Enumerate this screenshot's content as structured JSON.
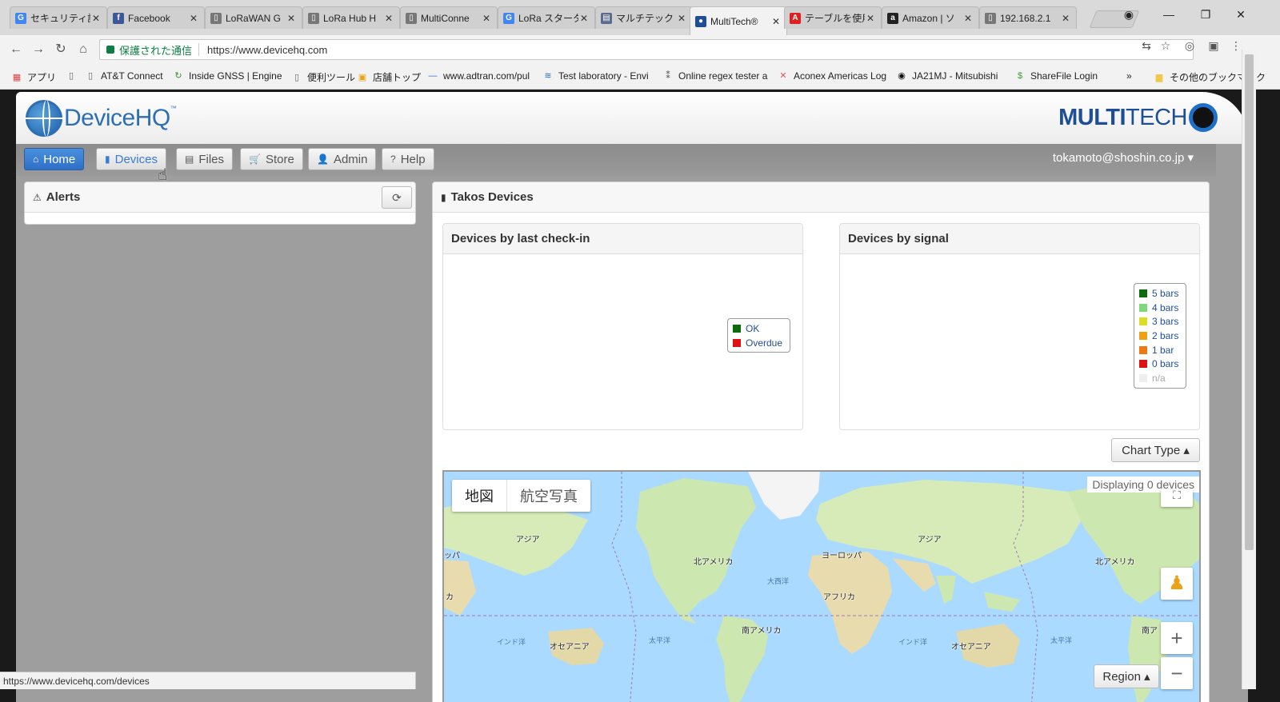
{
  "browser": {
    "tabs": [
      {
        "title": "セキュリティ設",
        "icon": "google-icon",
        "color": "#4285f4",
        "glyph": "G"
      },
      {
        "title": "Facebook",
        "icon": "facebook-icon",
        "color": "#3b5998",
        "glyph": "f"
      },
      {
        "title": "LoRaWAN G",
        "icon": "page-icon",
        "color": "#777777",
        "glyph": "▯"
      },
      {
        "title": "LoRa Hub H",
        "icon": "page-icon",
        "color": "#777777",
        "glyph": "▯"
      },
      {
        "title": "MultiConne",
        "icon": "page-icon",
        "color": "#777777",
        "glyph": "▯"
      },
      {
        "title": "LoRa スタータ",
        "icon": "google-icon",
        "color": "#4285f4",
        "glyph": "G"
      },
      {
        "title": "マルチテック L",
        "icon": "app-icon",
        "color": "#5a6b8c",
        "glyph": "▤"
      },
      {
        "title": "MultiTech®",
        "icon": "multitech-icon",
        "color": "#1e4f96",
        "glyph": "●"
      },
      {
        "title": "テーブルを使用",
        "icon": "adobe-icon",
        "color": "#e02020",
        "glyph": "A"
      },
      {
        "title": "Amazon | ソ",
        "icon": "amazon-icon",
        "color": "#222222",
        "glyph": "a"
      },
      {
        "title": "192.168.2.1",
        "icon": "page-icon",
        "color": "#777777",
        "glyph": "▯"
      }
    ],
    "active_tab": 7,
    "address": {
      "secure_label": "保護された通信",
      "url": "https://www.devicehq.com"
    },
    "bookmarks": [
      {
        "label": "アプリ",
        "icon": "apps-icon"
      },
      {
        "label": "",
        "icon": "page-icon"
      },
      {
        "label": "AT&T Connect",
        "icon": "page-icon"
      },
      {
        "label": "Inside GNSS | Engine",
        "icon": "gnss-icon"
      },
      {
        "label": "便利ツール",
        "icon": "page-icon"
      },
      {
        "label": "店舗トップ",
        "icon": "store-icon"
      },
      {
        "label": "www.adtran.com/pul",
        "icon": "adtran-icon"
      },
      {
        "label": "Test laboratory - Envi",
        "icon": "wifi-icon"
      },
      {
        "label": "Online regex tester a",
        "icon": "regex-icon"
      },
      {
        "label": "Aconex Americas Log",
        "icon": "aconex-icon"
      },
      {
        "label": "JA21MJ - Mitsubishi",
        "icon": "ja21-icon"
      },
      {
        "label": "ShareFile Login",
        "icon": "sharefile-icon"
      },
      {
        "label": "»",
        "icon": ""
      },
      {
        "label": "その他のブックマーク",
        "icon": "folder-icon"
      }
    ],
    "status_url": "https://www.devicehq.com/devices"
  },
  "app": {
    "brand": "DeviceHQ",
    "brand_tm": "™",
    "partner_bold": "MULTI",
    "partner_rest": "TECH",
    "nav": [
      {
        "label": "Home",
        "icon": "home-icon",
        "glyph": "⌂"
      },
      {
        "label": "Devices",
        "icon": "signal-icon",
        "glyph": "▮"
      },
      {
        "label": "Files",
        "icon": "file-icon",
        "glyph": "▤"
      },
      {
        "label": "Store",
        "icon": "cart-icon",
        "glyph": "🛒"
      },
      {
        "label": "Admin",
        "icon": "user-icon",
        "glyph": "👤"
      },
      {
        "label": "Help",
        "icon": "help-icon",
        "glyph": "?"
      }
    ],
    "user": "tokamoto@shoshin.co.jp ▾",
    "alerts_title": "Alerts",
    "devices_title": "Takos Devices",
    "checkin_title": "Devices by last check-in",
    "signal_title": "Devices by signal",
    "checkin_legend": [
      {
        "label": "OK",
        "color": "#0b6b0b"
      },
      {
        "label": "Overdue",
        "color": "#dd1111"
      }
    ],
    "signal_legend": [
      {
        "label": "5 bars",
        "color": "#0b6b0b"
      },
      {
        "label": "4 bars",
        "color": "#7fd67f"
      },
      {
        "label": "3 bars",
        "color": "#dddd22"
      },
      {
        "label": "2 bars",
        "color": "#f0a010"
      },
      {
        "label": "1 bar",
        "color": "#f07810"
      },
      {
        "label": "0 bars",
        "color": "#dd1111"
      },
      {
        "label": "n/a",
        "color": "#eeeeee"
      }
    ],
    "chart_type_label": "Chart Type ▴",
    "map": {
      "type_map": "地図",
      "type_satellite": "航空写真",
      "count_label": "Displaying 0 devices",
      "region_label": "Region ▴",
      "labels": {
        "asia1": "アジア",
        "asia2": "アジア",
        "na1": "北アメリカ",
        "na2": "北アメリカ",
        "europe": "ヨーロッパ",
        "africa": "アフリカ",
        "sa": "南アメリカ",
        "oceania1": "オセアニア",
        "oceania2": "オセアニア",
        "atlantic": "大西洋",
        "pacific1": "太平洋",
        "pacific2": "太平洋",
        "indian1": "インド洋",
        "indian2": "インド洋",
        "left_edge1": "ッパ",
        "left_edge2": "カ",
        "right_edge": "南ア"
      }
    }
  }
}
